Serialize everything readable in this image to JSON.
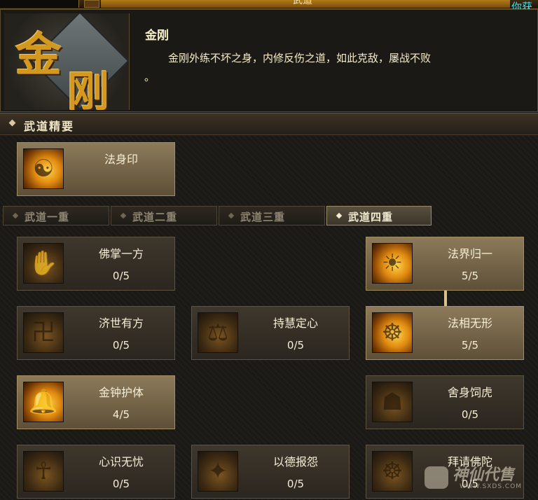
{
  "top_bar": {
    "title": "武道",
    "corner_text": "你获"
  },
  "header": {
    "emblem": {
      "char1": "金",
      "char2": "刚"
    },
    "name": "金刚",
    "description_line1": "金刚外练不坏之身，内修反伤之道，如此克敌，屡战不败",
    "description_line2": "。"
  },
  "section": {
    "title": "武道精要"
  },
  "essence": {
    "name": "法身印"
  },
  "tabs": [
    {
      "label": "武道一重",
      "active": false
    },
    {
      "label": "武道二重",
      "active": false
    },
    {
      "label": "武道三重",
      "active": false
    },
    {
      "label": "武道四重",
      "active": true
    }
  ],
  "skills": [
    {
      "name": "佛掌一方",
      "points": "0/5",
      "icon": "buddha-palm-icon"
    },
    {
      "name": "法界归一",
      "points": "5/5",
      "icon": "dharma-realm-icon"
    },
    {
      "name": "济世有方",
      "points": "0/5",
      "icon": "swastika-icon"
    },
    {
      "name": "持慧定心",
      "points": "0/5",
      "icon": "wisdom-icon"
    },
    {
      "name": "法相无形",
      "points": "5/5",
      "icon": "dharma-form-icon"
    },
    {
      "name": "金钟护体",
      "points": "4/5",
      "icon": "golden-bell-icon"
    },
    {
      "name": "舍身饲虎",
      "points": "0/5",
      "icon": "sacrifice-icon"
    },
    {
      "name": "心识无忧",
      "points": "0/5",
      "icon": "mind-icon"
    },
    {
      "name": "以德报怨",
      "points": "0/5",
      "icon": "virtue-icon"
    },
    {
      "name": "拜请佛陀",
      "points": "0/5",
      "icon": "pray-buddha-icon"
    }
  ],
  "watermark": {
    "text": "神仙代售",
    "url": "WWW.SXDS.COM"
  },
  "colors": {
    "gold": "#d2981f",
    "text": "#f6eed6",
    "corner": "#35e9ff"
  }
}
